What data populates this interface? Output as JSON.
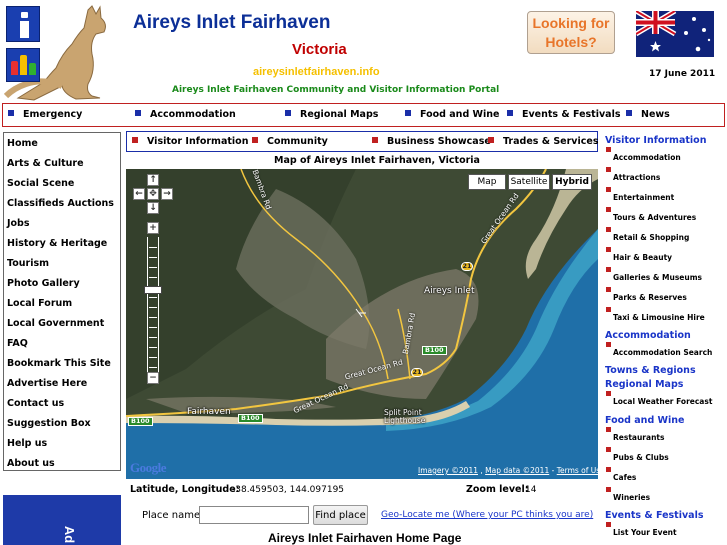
{
  "header": {
    "title": "Aireys Inlet Fairhaven",
    "state": "Victoria",
    "domain": "aireysinletfairhaven.info",
    "subtitle": "Aireys Inlet Fairhaven Community and Visitor Information Portal",
    "hotels_button": "Looking for Hotels?",
    "date": "17 June 2011",
    "icons": [
      "info-icon",
      "family-icon",
      "kangaroo-logo",
      "australian-flag"
    ]
  },
  "topnav": [
    {
      "label": "Emergency"
    },
    {
      "label": "Accommodation"
    },
    {
      "label": "Regional Maps"
    },
    {
      "label": "Food and Wine"
    },
    {
      "label": "Events & Festivals"
    },
    {
      "label": "News"
    }
  ],
  "subnav": [
    {
      "label": "Visitor Information"
    },
    {
      "label": "Community"
    },
    {
      "label": "Business Showcase"
    },
    {
      "label": "Trades & Services"
    }
  ],
  "leftnav": [
    "Home",
    "Arts & Culture",
    "Social Scene",
    "Classifieds Auctions",
    "Jobs",
    "History & Heritage",
    "Tourism",
    "Photo Gallery",
    "Local Forum",
    "Local Government",
    "FAQ",
    "Bookmark This Site",
    "Advertise Here",
    "Contact us",
    "Suggestion Box",
    "Help us",
    "About us"
  ],
  "ad": {
    "text": "Ad"
  },
  "map": {
    "title": "Map of Aireys Inlet Fairhaven, Victoria",
    "types": [
      {
        "label": "Map",
        "active": false
      },
      {
        "label": "Satellite",
        "active": false
      },
      {
        "label": "Hybrid",
        "active": true
      }
    ],
    "pan_glyphs": {
      "up": "↑",
      "left": "←",
      "center": "✥",
      "right": "→",
      "down": "↓"
    },
    "zoom_in": "+",
    "zoom_out": "−",
    "labels": {
      "town1": "Aireys Inlet",
      "town2": "Fairhaven",
      "lighthouse": "Split Point\nLighthouse",
      "road1": "Bambra Rd",
      "road2": "Great Ocean Rd",
      "road3": "Bambra Rd",
      "road4": "Great Ocean Rd",
      "road5": "Great Ocean Rd",
      "shield_21a": "21",
      "shield_21b": "21",
      "shield_b100a": "B100",
      "shield_b100b": "B100",
      "shield_b100c": "B100"
    },
    "google_logo": "Google",
    "attribution": {
      "imagery": "Imagery ©2011",
      "sep": " , ",
      "mapdata": "Map data ©2011",
      "dash": " - ",
      "terms": "Terms of Use"
    },
    "colors": {
      "land": "#3e4a34",
      "ocean": "#1f6fa8",
      "beach": "#d9cfae",
      "road": "#f2c640"
    }
  },
  "coords": {
    "latlng_label": "Latitude, Longitude:",
    "latlng_value": "-38.459503, 144.097195",
    "zoom_label": "Zoom level:",
    "zoom_value": "14"
  },
  "search": {
    "label": "Place name:",
    "value": "",
    "button": "Find place",
    "geolocate": "Geo-Locate me (Where your PC thinks you are)"
  },
  "home_title": "Aireys Inlet Fairhaven Home Page",
  "rightnav": {
    "visitor_head": "Visitor Information",
    "visitor_links": [
      "Accommodation",
      "Attractions",
      "Entertainment",
      "Tours & Adventures",
      "Retail & Shopping",
      "Hair & Beauty",
      "Galleries & Museums",
      "Parks & Reserves",
      "Taxi & Limousine Hire"
    ],
    "accommodation_head": "Accommodation",
    "accommodation_links": [
      "Accommodation Search"
    ],
    "towns_head": "Towns & Regions",
    "regional_head": "Regional Maps",
    "regional_links": [
      "Local Weather Forecast"
    ],
    "food_head": "Food and Wine",
    "food_links": [
      "Restaurants",
      "Pubs & Clubs",
      "Cafes",
      "Wineries"
    ],
    "events_head": "Events & Festivals",
    "events_links": [
      "List Your Event"
    ]
  }
}
